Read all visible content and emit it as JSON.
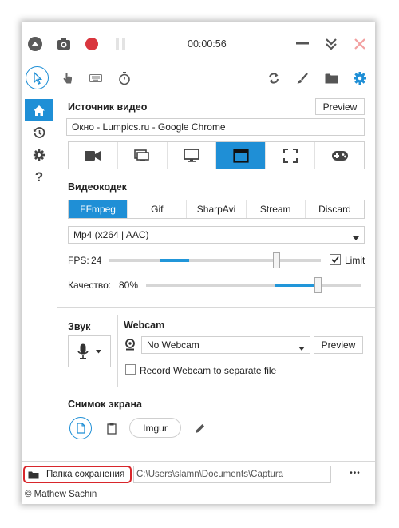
{
  "colors": {
    "accent": "#1f8fd6",
    "record": "#d9363e",
    "close": "#f2a0a0",
    "highlight": "#d8262b"
  },
  "topbar": {
    "timer": "00:00:56"
  },
  "source": {
    "heading": "Источник видео",
    "preview_label": "Preview",
    "window_value": "Окно  -  Lumpics.ru - Google Chrome",
    "selected_index": 4
  },
  "codec": {
    "heading": "Видеокодек",
    "tabs": [
      "FFmpeg",
      "Gif",
      "SharpAvi",
      "Stream",
      "Discard"
    ],
    "active_tab": "FFmpeg",
    "format_value": "Mp4 (x264 | AAC)",
    "fps_label": "FPS:",
    "fps_value": "24",
    "limit_label": "Limit",
    "limit_checked": true,
    "quality_label": "Качество:",
    "quality_value": "80%"
  },
  "audio": {
    "heading": "Звук"
  },
  "webcam": {
    "heading": "Webcam",
    "select_value": "No Webcam",
    "preview_label": "Preview",
    "separate_label": "Record Webcam to separate file"
  },
  "screenshot": {
    "heading": "Снимок экрана",
    "imgur_label": "Imgur"
  },
  "footer": {
    "folder_label": "Папка сохранения",
    "path": "C:\\Users\\slamn\\Documents\\Captura",
    "more_label": "•••"
  },
  "copyright": "© Mathew Sachin"
}
